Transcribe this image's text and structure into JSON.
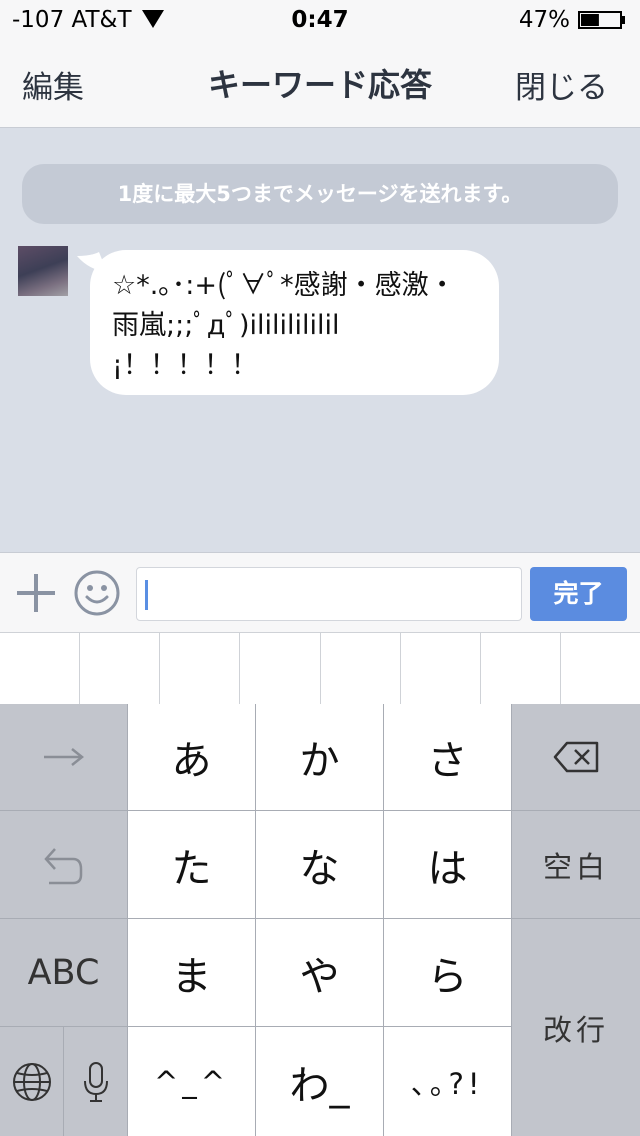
{
  "status_bar": {
    "carrier": "-107 AT&T",
    "time": "0:47",
    "battery": "47%",
    "battery_level": 0.47
  },
  "nav": {
    "edit_label": "編集",
    "title": "キーワード応答",
    "close_label": "閉じる"
  },
  "chat": {
    "notice": "1度に最大5つまでメッセージを送れます。",
    "message_lines": [
      "☆*.｡･:+(ﾟ∀ﾟ*感謝・感激・",
      "雨嵐;;;ﾟдﾟ)ilililililil",
      "¡！！！！！"
    ]
  },
  "input": {
    "value": "",
    "send_label": "完了"
  },
  "keyboard": {
    "row1": [
      "あ",
      "か",
      "さ"
    ],
    "row2": [
      "た",
      "な",
      "は"
    ],
    "row3": [
      "ま",
      "や",
      "ら"
    ],
    "row4": [
      "^_^",
      "わ_",
      "､｡?!"
    ],
    "abc_label": "ABC",
    "space_label": "空白",
    "return_label": "改行"
  },
  "colors": {
    "accent": "#5b8ce0",
    "chat_background": "#d9dee7",
    "bar_background": "#f7f7f8"
  }
}
